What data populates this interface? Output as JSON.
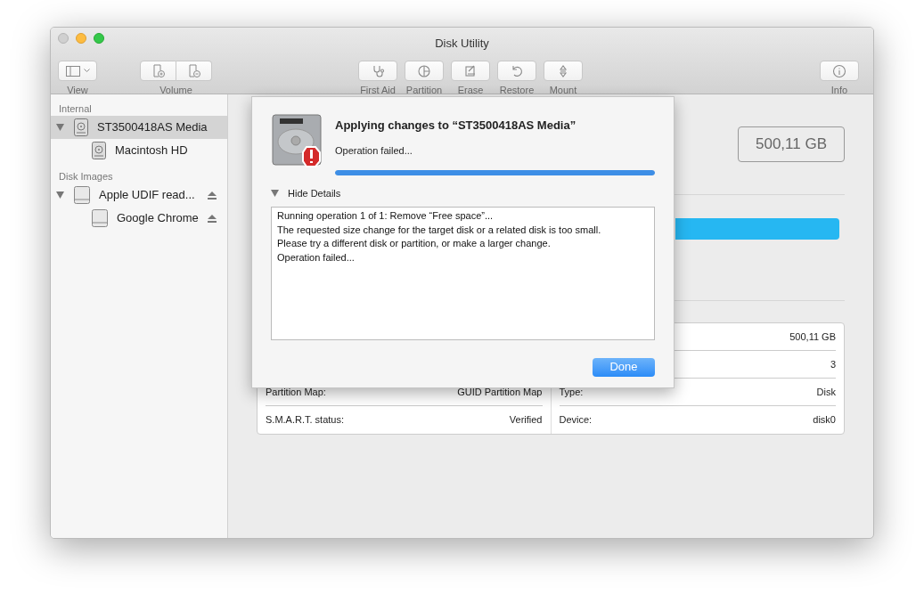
{
  "window": {
    "title": "Disk Utility"
  },
  "toolbar": {
    "left": [
      {
        "kind": "view",
        "label": "View"
      },
      {
        "kind": "volume",
        "label": "Volume"
      }
    ],
    "center": [
      {
        "kind": "firstaid",
        "label": "First Aid"
      },
      {
        "kind": "partition",
        "label": "Partition"
      },
      {
        "kind": "erase",
        "label": "Erase"
      },
      {
        "kind": "restore",
        "label": "Restore"
      },
      {
        "kind": "mount",
        "label": "Mount"
      }
    ],
    "right": [
      {
        "kind": "info",
        "label": "Info"
      }
    ]
  },
  "sidebar": {
    "sections": [
      {
        "title": "Internal",
        "items": [
          {
            "name": "ST3500418AS Media",
            "kind": "internal",
            "selected": true,
            "expanded": true,
            "eject": false,
            "children": [
              {
                "name": "Macintosh HD",
                "kind": "internal",
                "selected": false,
                "eject": false
              }
            ]
          }
        ]
      },
      {
        "title": "Disk Images",
        "items": [
          {
            "name": "Apple UDIF read...",
            "kind": "image",
            "selected": false,
            "expanded": true,
            "eject": true,
            "children": [
              {
                "name": "Google Chrome",
                "kind": "image",
                "selected": false,
                "eject": true
              }
            ]
          }
        ]
      }
    ]
  },
  "content": {
    "capacity": "500,11 GB",
    "info_table": {
      "rows": [
        {
          "right_value": "500,11 GB"
        },
        {
          "right_value": "3"
        },
        {
          "left_label": "Partition Map:",
          "left_value": "GUID Partition Map",
          "right_label": "Type:",
          "right_value": "Disk"
        },
        {
          "left_label": "S.M.A.R.T. status:",
          "left_value": "Verified",
          "right_label": "Device:",
          "right_value": "disk0"
        }
      ]
    }
  },
  "sheet": {
    "title": "Applying changes to “ST3500418AS Media”",
    "status": "Operation failed...",
    "progress": {
      "level": 1
    },
    "details_toggle": {
      "label": "Hide Details",
      "expanded": true
    },
    "log": [
      "Running operation 1 of 1: Remove “Free space”...",
      "The requested size change for the target disk or a related disk is too small.\nPlease try a different disk or partition, or make a larger change.",
      "Operation failed..."
    ],
    "button": "Done"
  }
}
